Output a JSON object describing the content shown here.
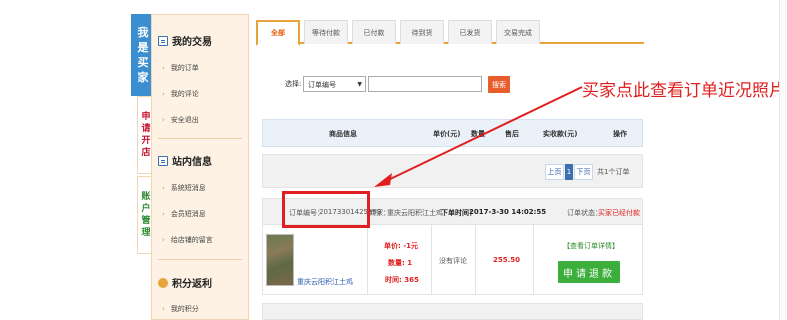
{
  "side_tabs": {
    "buyer": [
      "我",
      "是",
      "买",
      "家"
    ],
    "shop": [
      "申",
      "请",
      "开",
      "店"
    ],
    "account": [
      "账",
      "户",
      "管",
      "理"
    ]
  },
  "sidebar": {
    "sections": [
      {
        "title": "我的交易",
        "items": [
          "我的订单",
          "我的评论",
          "安全退出"
        ]
      },
      {
        "title": "站内信息",
        "items": [
          "系统短消息",
          "会员短消息",
          "给店铺的留言"
        ]
      },
      {
        "title": "积分返利",
        "items": [
          "我的积分"
        ]
      }
    ]
  },
  "tabs": [
    "全部",
    "等待付款",
    "已付款",
    "待到货",
    "已发货",
    "交易完成"
  ],
  "search": {
    "label": "选择:",
    "select_value": "订单编号",
    "input_value": "",
    "button": "搜索"
  },
  "table_headers": [
    "商品信息",
    "单价(元)",
    "数量",
    "售后",
    "实收款(元)",
    "操作"
  ],
  "pagination": {
    "prev": "上页",
    "current": "1",
    "next": "下页",
    "total": "共1个订单"
  },
  "order": {
    "number_label": "订单编号：",
    "number": "20173301425559",
    "seller_label": "商家：",
    "seller": "重庆云阳积江土鸡",
    "time_label": "下单时间：",
    "time": "2017-3-30 14:02:55",
    "status_label": "订单状态：",
    "status": "买家已经付款",
    "product_name": "重庆云阳积江土鸡",
    "unit_price": "单价: -1元",
    "quantity": "数量: 1",
    "time_info": "时间: 365",
    "after_sale": "没有评论",
    "amount": "255.50",
    "detail_link": "【查看订单详情】",
    "refund_button": "申请退款"
  },
  "annotation": "买家点此查看订单近况照片",
  "colors": {
    "accent": "#e8a33a",
    "blue": "#3b8fd0",
    "red": "#e02020",
    "green": "#3cae3c"
  }
}
